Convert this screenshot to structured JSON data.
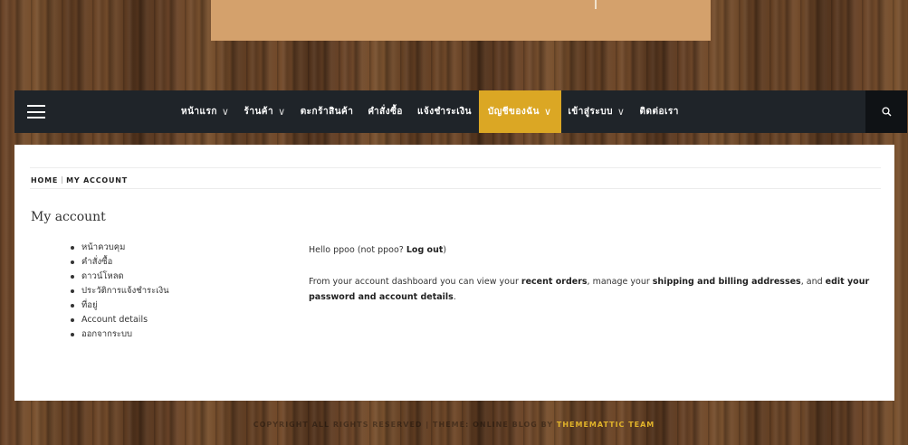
{
  "nav": {
    "items": [
      {
        "label": "หน้าแรก",
        "dropdown": true,
        "active": false
      },
      {
        "label": "ร้านค้า",
        "dropdown": true,
        "active": false
      },
      {
        "label": "ตะกร้าสินค้า",
        "dropdown": false,
        "active": false
      },
      {
        "label": "คำสั่งซื้อ",
        "dropdown": false,
        "active": false
      },
      {
        "label": "แจ้งชำระเงิน",
        "dropdown": false,
        "active": false
      },
      {
        "label": "บัญชีของฉัน",
        "dropdown": true,
        "active": true
      },
      {
        "label": "เข้าสู่ระบบ",
        "dropdown": true,
        "active": false
      },
      {
        "label": "ติดต่อเรา",
        "dropdown": false,
        "active": false
      }
    ],
    "accent_color": "#dba724"
  },
  "breadcrumb": {
    "home": "HOME",
    "current": "MY ACCOUNT"
  },
  "page": {
    "title": "My account"
  },
  "account_nav": [
    "หน้าควบคุม",
    "คำสั่งซื้อ",
    "ดาวน์โหลด",
    "ประวัติการแจ้งชำระเงิน",
    "ที่อยู่",
    "Account details",
    "ออกจากระบบ"
  ],
  "account_content": {
    "hello_prefix": "Hello ",
    "username": "ppoo",
    "not_prefix": " (not ",
    "not_username": "ppoo",
    "not_suffix": "? ",
    "logout_link": "Log out",
    "close_paren": ")",
    "dash_1": "From your account dashboard you can view your ",
    "recent_orders_link": "recent orders",
    "dash_2": ", manage your ",
    "addresses_link": "shipping and billing addresses",
    "dash_3": ", and ",
    "edit_link": "edit your password and account details",
    "dash_4": "."
  },
  "footer": {
    "text": "COPYRIGHT ALL RIGHTS RESERVED | THEME: ONLINE BLOG BY ",
    "brand": "THEMEMATTIC TEAM"
  }
}
